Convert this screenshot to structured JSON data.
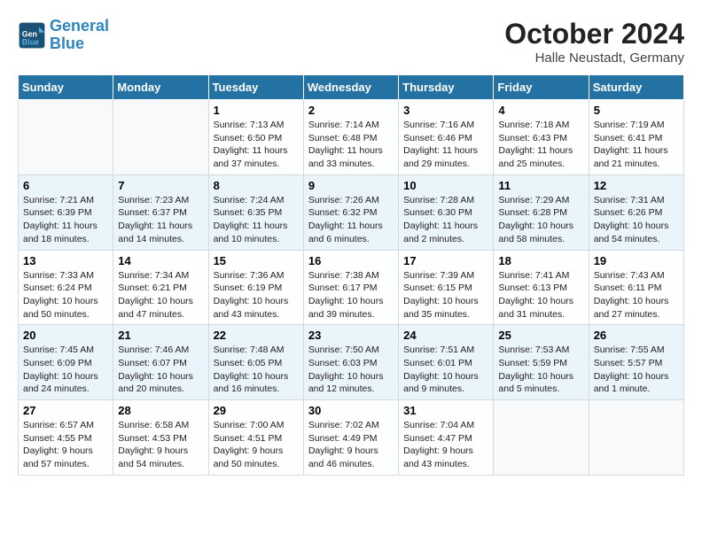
{
  "header": {
    "logo_line1": "General",
    "logo_line2": "Blue",
    "month": "October 2024",
    "location": "Halle Neustadt, Germany"
  },
  "weekdays": [
    "Sunday",
    "Monday",
    "Tuesday",
    "Wednesday",
    "Thursday",
    "Friday",
    "Saturday"
  ],
  "weeks": [
    [
      {
        "day": "",
        "info": ""
      },
      {
        "day": "",
        "info": ""
      },
      {
        "day": "1",
        "info": "Sunrise: 7:13 AM\nSunset: 6:50 PM\nDaylight: 11 hours and 37 minutes."
      },
      {
        "day": "2",
        "info": "Sunrise: 7:14 AM\nSunset: 6:48 PM\nDaylight: 11 hours and 33 minutes."
      },
      {
        "day": "3",
        "info": "Sunrise: 7:16 AM\nSunset: 6:46 PM\nDaylight: 11 hours and 29 minutes."
      },
      {
        "day": "4",
        "info": "Sunrise: 7:18 AM\nSunset: 6:43 PM\nDaylight: 11 hours and 25 minutes."
      },
      {
        "day": "5",
        "info": "Sunrise: 7:19 AM\nSunset: 6:41 PM\nDaylight: 11 hours and 21 minutes."
      }
    ],
    [
      {
        "day": "6",
        "info": "Sunrise: 7:21 AM\nSunset: 6:39 PM\nDaylight: 11 hours and 18 minutes."
      },
      {
        "day": "7",
        "info": "Sunrise: 7:23 AM\nSunset: 6:37 PM\nDaylight: 11 hours and 14 minutes."
      },
      {
        "day": "8",
        "info": "Sunrise: 7:24 AM\nSunset: 6:35 PM\nDaylight: 11 hours and 10 minutes."
      },
      {
        "day": "9",
        "info": "Sunrise: 7:26 AM\nSunset: 6:32 PM\nDaylight: 11 hours and 6 minutes."
      },
      {
        "day": "10",
        "info": "Sunrise: 7:28 AM\nSunset: 6:30 PM\nDaylight: 11 hours and 2 minutes."
      },
      {
        "day": "11",
        "info": "Sunrise: 7:29 AM\nSunset: 6:28 PM\nDaylight: 10 hours and 58 minutes."
      },
      {
        "day": "12",
        "info": "Sunrise: 7:31 AM\nSunset: 6:26 PM\nDaylight: 10 hours and 54 minutes."
      }
    ],
    [
      {
        "day": "13",
        "info": "Sunrise: 7:33 AM\nSunset: 6:24 PM\nDaylight: 10 hours and 50 minutes."
      },
      {
        "day": "14",
        "info": "Sunrise: 7:34 AM\nSunset: 6:21 PM\nDaylight: 10 hours and 47 minutes."
      },
      {
        "day": "15",
        "info": "Sunrise: 7:36 AM\nSunset: 6:19 PM\nDaylight: 10 hours and 43 minutes."
      },
      {
        "day": "16",
        "info": "Sunrise: 7:38 AM\nSunset: 6:17 PM\nDaylight: 10 hours and 39 minutes."
      },
      {
        "day": "17",
        "info": "Sunrise: 7:39 AM\nSunset: 6:15 PM\nDaylight: 10 hours and 35 minutes."
      },
      {
        "day": "18",
        "info": "Sunrise: 7:41 AM\nSunset: 6:13 PM\nDaylight: 10 hours and 31 minutes."
      },
      {
        "day": "19",
        "info": "Sunrise: 7:43 AM\nSunset: 6:11 PM\nDaylight: 10 hours and 27 minutes."
      }
    ],
    [
      {
        "day": "20",
        "info": "Sunrise: 7:45 AM\nSunset: 6:09 PM\nDaylight: 10 hours and 24 minutes."
      },
      {
        "day": "21",
        "info": "Sunrise: 7:46 AM\nSunset: 6:07 PM\nDaylight: 10 hours and 20 minutes."
      },
      {
        "day": "22",
        "info": "Sunrise: 7:48 AM\nSunset: 6:05 PM\nDaylight: 10 hours and 16 minutes."
      },
      {
        "day": "23",
        "info": "Sunrise: 7:50 AM\nSunset: 6:03 PM\nDaylight: 10 hours and 12 minutes."
      },
      {
        "day": "24",
        "info": "Sunrise: 7:51 AM\nSunset: 6:01 PM\nDaylight: 10 hours and 9 minutes."
      },
      {
        "day": "25",
        "info": "Sunrise: 7:53 AM\nSunset: 5:59 PM\nDaylight: 10 hours and 5 minutes."
      },
      {
        "day": "26",
        "info": "Sunrise: 7:55 AM\nSunset: 5:57 PM\nDaylight: 10 hours and 1 minute."
      }
    ],
    [
      {
        "day": "27",
        "info": "Sunrise: 6:57 AM\nSunset: 4:55 PM\nDaylight: 9 hours and 57 minutes."
      },
      {
        "day": "28",
        "info": "Sunrise: 6:58 AM\nSunset: 4:53 PM\nDaylight: 9 hours and 54 minutes."
      },
      {
        "day": "29",
        "info": "Sunrise: 7:00 AM\nSunset: 4:51 PM\nDaylight: 9 hours and 50 minutes."
      },
      {
        "day": "30",
        "info": "Sunrise: 7:02 AM\nSunset: 4:49 PM\nDaylight: 9 hours and 46 minutes."
      },
      {
        "day": "31",
        "info": "Sunrise: 7:04 AM\nSunset: 4:47 PM\nDaylight: 9 hours and 43 minutes."
      },
      {
        "day": "",
        "info": ""
      },
      {
        "day": "",
        "info": ""
      }
    ]
  ]
}
